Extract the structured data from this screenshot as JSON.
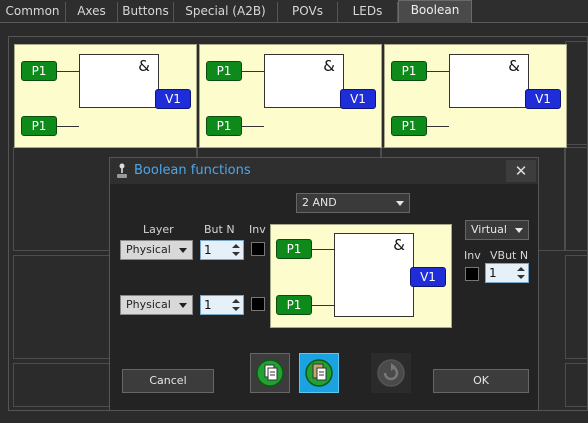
{
  "tabs": [
    {
      "label": "Common"
    },
    {
      "label": "Axes"
    },
    {
      "label": "Buttons"
    },
    {
      "label": "Special (A2B)"
    },
    {
      "label": "POVs"
    },
    {
      "label": "LEDs"
    },
    {
      "label": "Boolean",
      "active": true
    }
  ],
  "cells": [
    {
      "op": "&",
      "in1": "P1",
      "in2": "P1",
      "out": "V1"
    },
    {
      "op": "&",
      "in1": "P1",
      "in2": "P1",
      "out": "V1"
    },
    {
      "op": "&",
      "in1": "P1",
      "in2": "P1",
      "out": "V1"
    }
  ],
  "dialog": {
    "title": "Boolean functions",
    "close": "✕",
    "function": "2 AND",
    "layer_label": "Layer",
    "butn_label": "But N",
    "inv_label": "Inv",
    "row1": {
      "layer": "Physical",
      "butn": "1"
    },
    "row2": {
      "layer": "Physical",
      "butn": "1"
    },
    "output_type": "Virtual",
    "out_inv_label": "Inv",
    "vbutn_label": "VBut N",
    "vbutn": "1",
    "preview": {
      "op": "&",
      "in1": "P1",
      "in2": "P1",
      "out": "V1"
    },
    "cancel": "Cancel",
    "ok": "OK"
  },
  "colors": {
    "accent_title": "#4fa6e8",
    "cell_bg": "#fdfccc",
    "input_green": "#0e8a1a",
    "output_blue": "#1f2dd8",
    "highlight": "#1aa3e0"
  }
}
